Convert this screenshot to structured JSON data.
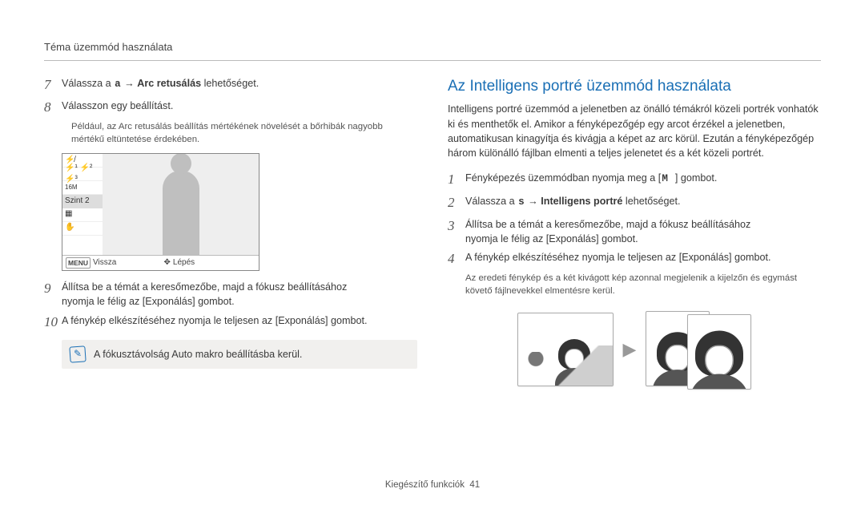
{
  "header": {
    "title": "Téma üzemmód használata"
  },
  "footer": {
    "section": "Kiegészítő funkciók",
    "page": "41"
  },
  "left": {
    "step7": {
      "num": "7",
      "pre": "Válassza a ",
      "glyph": "a",
      "arrow": " → ",
      "target": "Arc retusálás",
      "post": " lehetőséget."
    },
    "step8": {
      "num": "8",
      "text": "Válasszon egy beállítást."
    },
    "example": "Például, az Arc retusálás beállítás mértékének növelését a bőrhibák nagyobb mértékű eltüntetése érdekében.",
    "lcd": {
      "level": "Szint 2",
      "back_key": "MENU",
      "back_label": "Vissza",
      "move_label": "Lépés"
    },
    "step9": {
      "num": "9",
      "line1": "Állítsa be a témát a keresőmezőbe, majd a fókusz beállításához",
      "line2": "nyomja le félig az [Exponálás] gombot."
    },
    "step10": {
      "num": "10",
      "text": "A fénykép elkészítéséhez nyomja le teljesen az [Exponálás] gombot."
    },
    "note": "A fókusztávolság Auto makro beállításba kerül."
  },
  "right": {
    "heading": "Az Intelligens portré üzemmód használata",
    "intro": "Intelligens portré üzemmód a jelenetben az önálló témákról közeli portrék vonhatók ki és menthetők el. Amikor a fényképezőgép egy arcot érzékel a jelenetben, automatikusan kinagyítja és kivágja a képet az arc körül. Ezután a fényképezőgép három különálló fájlban elmenti a teljes jelenetet és a két közeli portrét.",
    "step1": {
      "num": "1",
      "pre": "Fényképezés üzemmódban nyomja meg a [",
      "key": "M",
      "post": "] gombot."
    },
    "step2": {
      "num": "2",
      "pre": "Válassza a ",
      "glyph": "s",
      "arrow": " → ",
      "target": "Intelligens portré",
      "post": " lehetőséget."
    },
    "step3": {
      "num": "3",
      "line1": "Állítsa be a témát a keresőmezőbe, majd a fókusz beállításához",
      "line2": "nyomja le félig az [Exponálás] gombot."
    },
    "step4": {
      "num": "4",
      "text": "A fénykép elkészítéséhez nyomja le teljesen az [Exponálás] gombot."
    },
    "sub": "Az eredeti fénykép és a két kivágott kép azonnal megjelenik a kijelzőn és egymást követő fájlnevekkel elmentésre kerül."
  }
}
